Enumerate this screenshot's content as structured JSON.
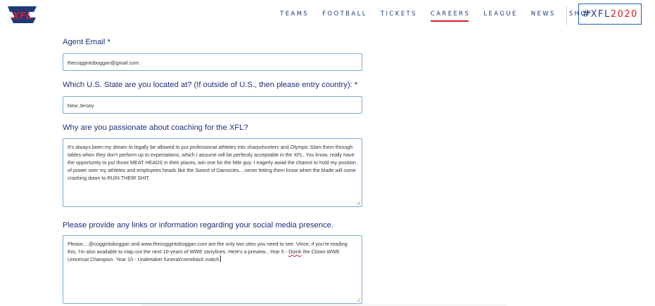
{
  "header": {
    "nav": [
      {
        "label": "TEAMS",
        "active": false
      },
      {
        "label": "FOOTBALL",
        "active": false
      },
      {
        "label": "TICKETS",
        "active": false
      },
      {
        "label": "CAREERS",
        "active": true
      },
      {
        "label": "LEAGUE",
        "active": false
      },
      {
        "label": "NEWS",
        "active": false
      },
      {
        "label": "SHOP",
        "active": false
      }
    ],
    "hashtag_prefix": "#XFL",
    "hashtag_year": "2020"
  },
  "colors": {
    "navy": "#1e2e78",
    "red": "#d0202e",
    "field_border": "#7fa8d8"
  },
  "form": {
    "agent_email": {
      "label": "Agent Email",
      "required": "*",
      "value": "thecoggintoboggan@gmail.com"
    },
    "state": {
      "label": "Which U.S. State are you located at? (If outside of U.S., then please entry country):",
      "required": "*",
      "value": "New Jersey"
    },
    "passion": {
      "label": "Why are you passionate about coaching for the XFL?",
      "value": "It's always been my dream to legally be allowed to put professional athletes into sharpshooters and Olympic Slam them through tables when they don't perform up to expectations, which I assume will be perfectly acceptable in the XFL. You know, really have the opportunity to put those MEAT HEADS in their places, win one for the little guy. I eagerly await the chance to hold my position of power over my athletes and employees heads like the Sword of Damocles....never letting them know when the blade will come crashing down to RUIN THEIR SHIT."
    },
    "social": {
      "label": "Please provide any links or information regarding your social media presence.",
      "value_before": "Please....@coggintoboggan and www.thecoggintoboggan.com are the only two sites you need to see. Vince, if you're reading this, I'm also available to map out the next 10-years of WWE storylines. Here's a preview...Year 5 - ",
      "value_misspelled": "Doink",
      "value_after": " the Clown WWE Universal Champion. Year 10 - Undertaker funeral/comeback match."
    }
  }
}
